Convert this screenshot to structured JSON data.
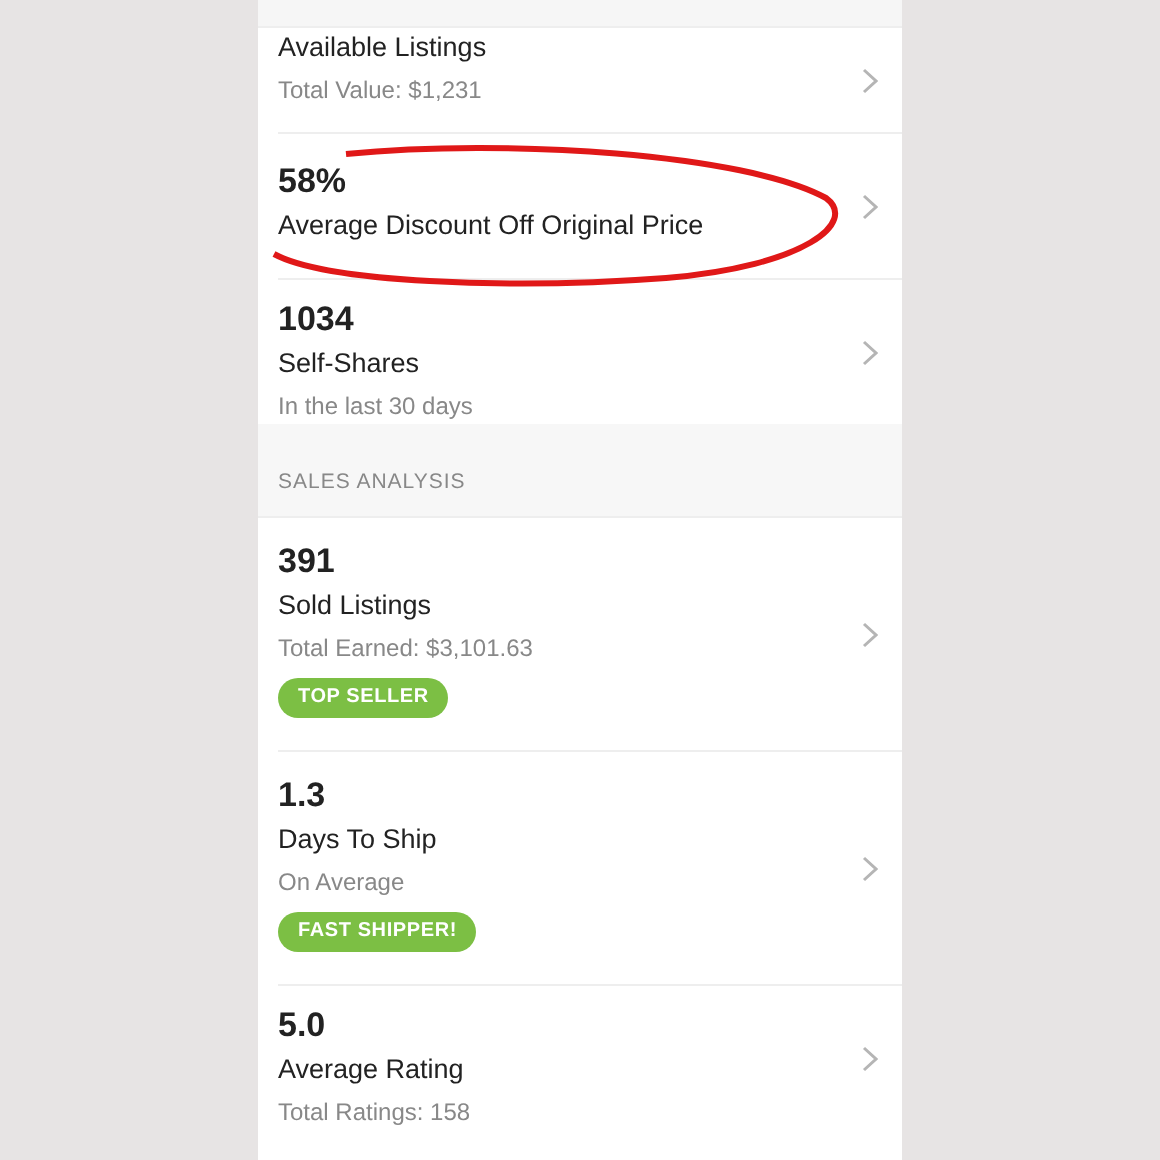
{
  "stats": [
    {
      "title": "Available Listings",
      "subtitle": "Total Value: $1,231",
      "circled": false
    },
    {
      "value": "58%",
      "title": "Average Discount Off Original Price",
      "circled": true
    },
    {
      "value": "1034",
      "title": "Self-Shares",
      "subtitle": "In the last 30 days",
      "circled": false
    }
  ],
  "section": {
    "heading": "SALES ANALYSIS"
  },
  "sales": [
    {
      "value": "391",
      "title": "Sold Listings",
      "subtitle": "Total Earned: $3,101.63",
      "badge": "TOP SELLER",
      "circled": false
    },
    {
      "value": "1.3",
      "title": "Days To Ship",
      "subtitle": "On Average",
      "badge": "FAST SHIPPER!",
      "circled": false
    },
    {
      "value": "5.0",
      "title": "Average Rating",
      "subtitle": "Total Ratings: 158",
      "circled": false
    }
  ]
}
